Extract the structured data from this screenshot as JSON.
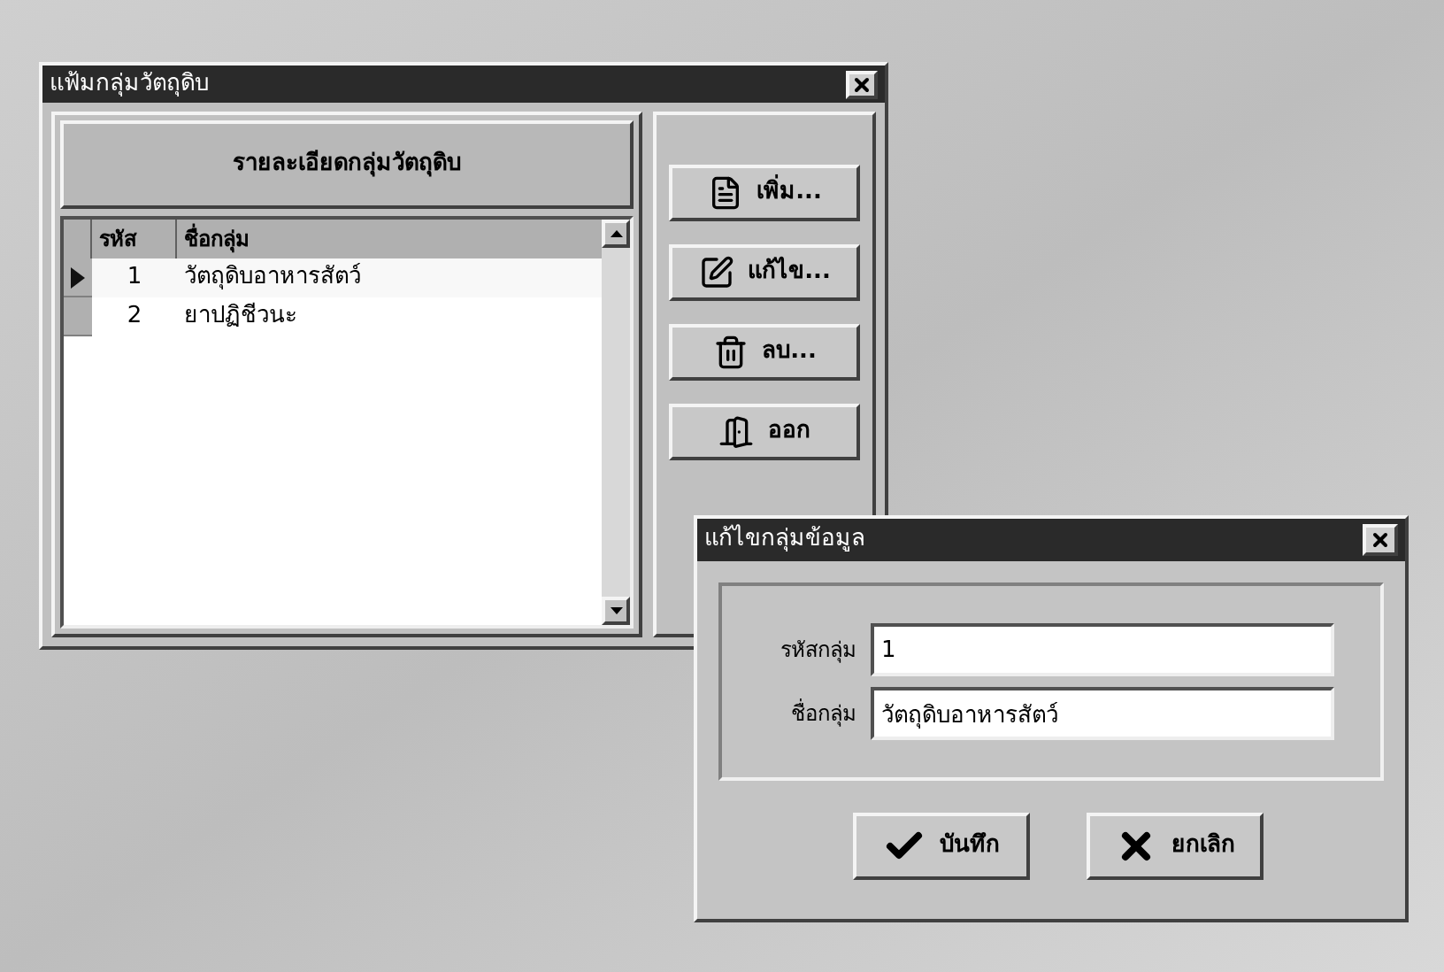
{
  "main_window": {
    "title": "แฟ้มกลุ่มวัตถุดิบ",
    "panel_heading": "รายละเอียดกลุ่มวัตถุดิบ",
    "table": {
      "columns": [
        "รหัส",
        "ชื่อกลุ่ม"
      ],
      "rows": [
        {
          "code": "1",
          "name": "วัตถุดิบอาหารสัตว์",
          "selected": true
        },
        {
          "code": "2",
          "name": "ยาปฏิชีวนะ",
          "selected": false
        }
      ]
    },
    "buttons": [
      {
        "kind": "add",
        "label": "เพิ่ม..."
      },
      {
        "kind": "edit",
        "label": "แก้ไข..."
      },
      {
        "kind": "delete",
        "label": "ลบ..."
      },
      {
        "kind": "exit",
        "label": "ออก"
      }
    ]
  },
  "dialog": {
    "title": "แก้ไขกลุ่มข้อมูล",
    "fields": [
      {
        "label": "รหัสกลุ่ม",
        "value": "1"
      },
      {
        "label": "ชื่อกลุ่ม",
        "value": "วัตถุดิบอาหารสัตว์"
      }
    ],
    "buttons": [
      {
        "kind": "save",
        "label": "บันทึก"
      },
      {
        "kind": "cancel",
        "label": "ยกเลิก"
      }
    ]
  }
}
